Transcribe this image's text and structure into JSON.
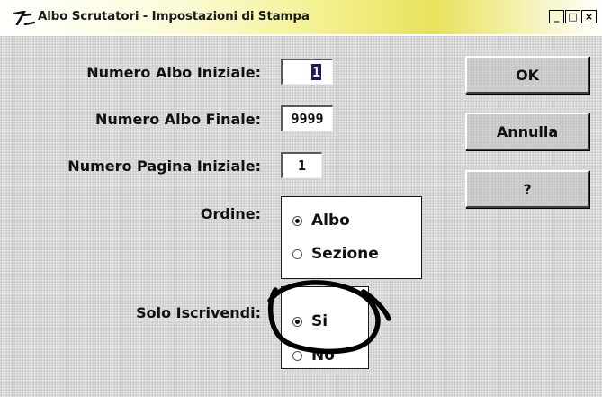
{
  "window": {
    "title": "Albo Scrutatori - Impostazioni di Stampa",
    "controls": {
      "minimize": "_",
      "maximize": "□",
      "close": "×"
    }
  },
  "form": {
    "numero_albo_iniziale": {
      "label": "Numero Albo Iniziale:",
      "value": "1"
    },
    "numero_albo_finale": {
      "label": "Numero Albo Finale:",
      "value": "9999"
    },
    "numero_pagina_iniziale": {
      "label": "Numero Pagina Iniziale:",
      "value": "1"
    },
    "ordine": {
      "label": "Ordine:",
      "options": [
        {
          "label": "Albo",
          "selected": true
        },
        {
          "label": "Sezione",
          "selected": false
        }
      ]
    },
    "solo_iscrivendi": {
      "label": "Solo Iscrivendi:",
      "options": [
        {
          "label": "Si",
          "selected": true
        },
        {
          "label": "No",
          "selected": false
        }
      ]
    }
  },
  "buttons": {
    "ok": "OK",
    "annulla": "Annulla",
    "help": "?"
  },
  "icons": {
    "app": "app-logo-icon",
    "annotation": "hand-drawn-circle"
  },
  "colors": {
    "dialog_background": "#d8d8d8",
    "titlebar_accent": "#e8e25c",
    "field_selection": "#1a1a5a",
    "annotation": "#000000"
  }
}
